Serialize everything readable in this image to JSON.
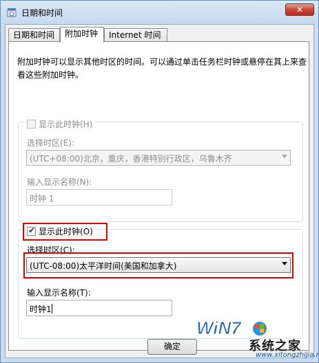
{
  "window": {
    "title": "日期和时间",
    "close_label": "✕"
  },
  "tabs": [
    {
      "label": "日期和时间",
      "active": false
    },
    {
      "label": "附加时钟",
      "active": true
    },
    {
      "label": "Internet 时间",
      "active": false
    }
  ],
  "description": "附加时钟可以显示其他时区的时间。可以通过单击任务栏时钟或悬停在其上来查看这些附加时钟。",
  "clock1": {
    "show_label": "显示此时钟(H)",
    "checked": false,
    "timezone_label": "选择时区(E):",
    "timezone_value": "(UTC+08:00)北京，重庆，香港特别行政区，乌鲁木齐",
    "name_label": "输入显示名称(N):",
    "name_value": "时钟 1"
  },
  "clock2": {
    "show_label": "显示此时钟(O)",
    "checked": true,
    "timezone_label": "选择时区(C):",
    "timezone_value": "(UTC-08:00)太平洋时间(美国和加拿大)",
    "name_label": "输入显示名称(T):",
    "name_value": "时钟1"
  },
  "buttons": {
    "ok": "确定"
  },
  "watermark": {
    "brand": "WiN7",
    "text": "系统之家",
    "url": "www.xitongzhijia.net"
  },
  "colors": {
    "highlight": "#e00000",
    "title_bar": "#c5d9ef"
  }
}
